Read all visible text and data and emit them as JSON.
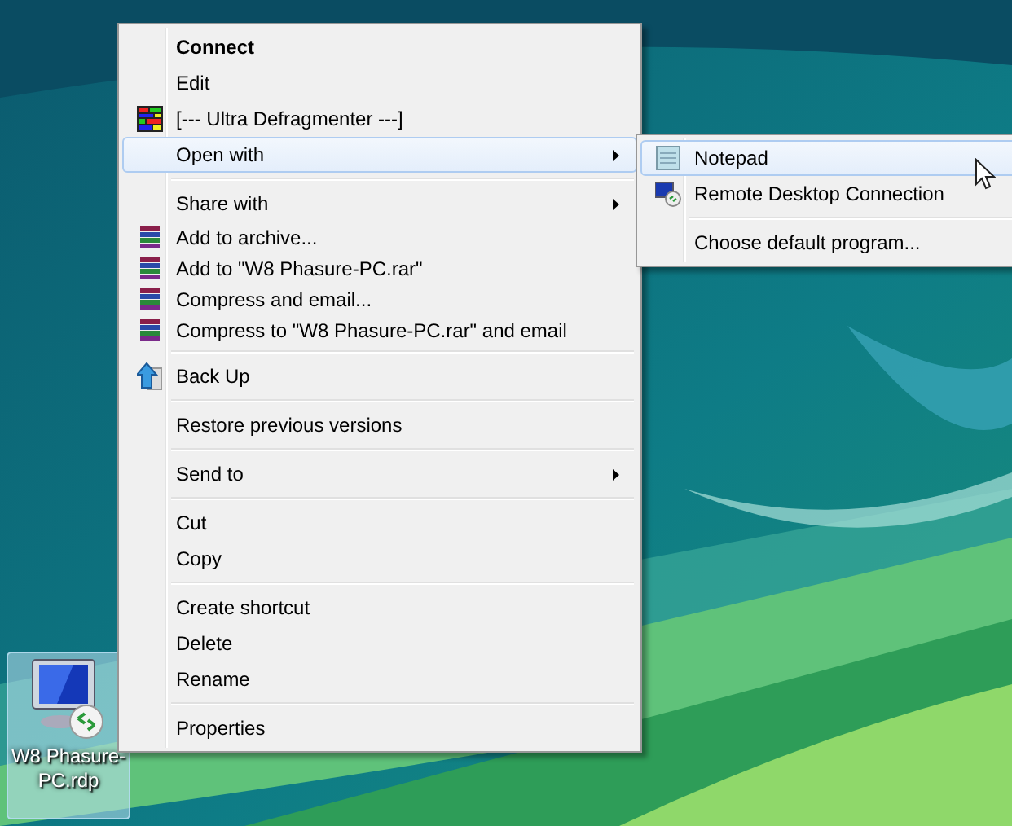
{
  "menu": {
    "groups": [
      {
        "items": [
          {
            "label": "Connect",
            "bold": true,
            "selected": false
          },
          {
            "label": "Edit",
            "selected": false
          },
          {
            "label": "[--- Ultra Defragmenter ---]",
            "kind": "defrag",
            "selected": false
          },
          {
            "label": "Open with",
            "submenu": true,
            "selected": true
          }
        ]
      },
      {
        "items": [
          {
            "label": "Share with",
            "submenu": true,
            "selected": false
          },
          {
            "label": "Add to archive...",
            "kind": "archive",
            "selected": false
          },
          {
            "label": "Add to \"W8 Phasure-PC.rar\"",
            "kind": "archive",
            "selected": false
          },
          {
            "label": "Compress and email...",
            "kind": "archive",
            "selected": false
          },
          {
            "label": "Compress to \"W8 Phasure-PC.rar\" and email",
            "kind": "archive",
            "selected": false
          }
        ]
      },
      {
        "items": [
          {
            "label": "Back Up",
            "kind": "backup",
            "selected": false
          }
        ]
      },
      {
        "items": [
          {
            "label": "Restore previous versions",
            "selected": false
          }
        ]
      },
      {
        "items": [
          {
            "label": "Send to",
            "submenu": true,
            "selected": false
          }
        ]
      },
      {
        "items": [
          {
            "label": "Cut",
            "selected": false
          },
          {
            "label": "Copy",
            "selected": false
          }
        ]
      },
      {
        "items": [
          {
            "label": "Create shortcut",
            "selected": false
          },
          {
            "label": "Delete",
            "selected": false
          },
          {
            "label": "Rename",
            "selected": false
          }
        ]
      },
      {
        "items": [
          {
            "label": "Properties",
            "selected": false
          }
        ]
      }
    ]
  },
  "submenu": {
    "groups": [
      {
        "items": [
          {
            "label": "Notepad",
            "kind": "notepad",
            "selected": true
          },
          {
            "label": "Remote Desktop Connection",
            "kind": "remote",
            "selected": false
          }
        ]
      },
      {
        "items": [
          {
            "label": "Choose default program...",
            "selected": false
          }
        ]
      }
    ]
  },
  "desktop_icon": {
    "label": "W8 Phasure-PC.rdp",
    "selected": true
  }
}
